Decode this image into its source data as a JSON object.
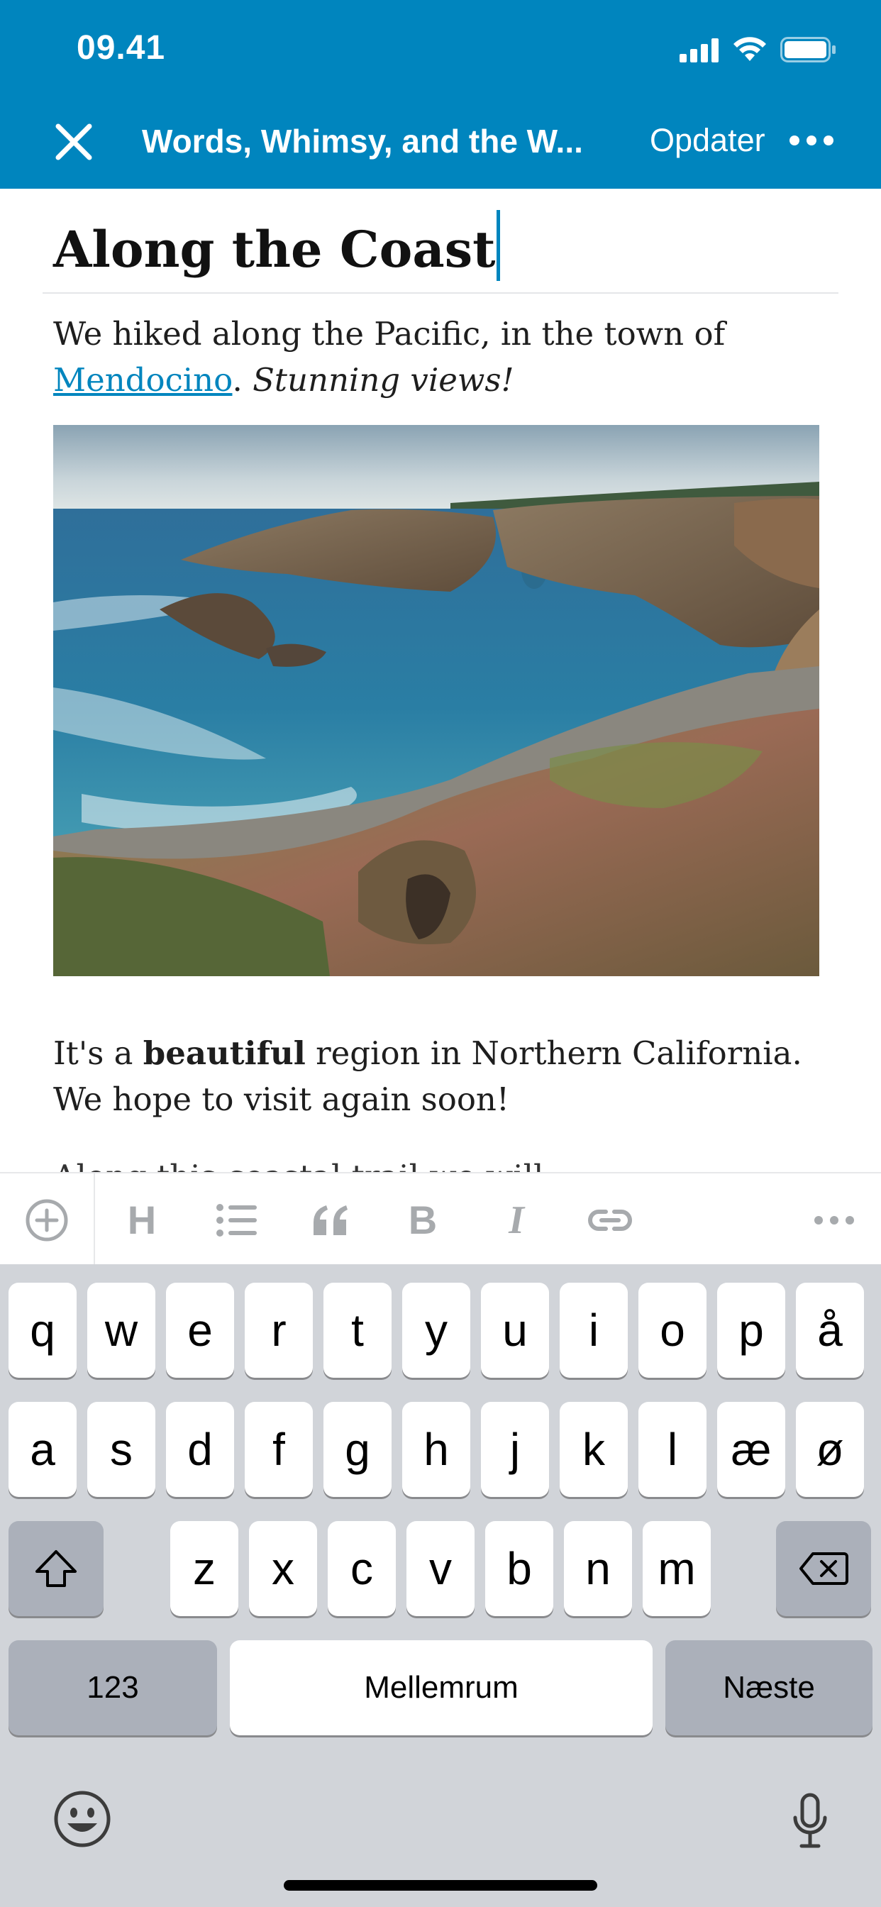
{
  "status": {
    "time": "09.41"
  },
  "header": {
    "doc_title": "Words, Whimsy, and the W...",
    "update_label": "Opdater"
  },
  "post": {
    "title": "Along the Coast",
    "p1_text_a": "We hiked along the Pacific, in the town of ",
    "p1_link": "Mendocino",
    "p1_text_b": ". ",
    "p1_italic": "Stunning views!",
    "p2_text_a": "It's a ",
    "p2_bold": "beautiful",
    "p2_text_b": " region in Northern California. We hope to visit again soon!",
    "p3_partial": "Along this coastal trail we will..."
  },
  "toolbar": {
    "heading_label": "H",
    "bold_label": "B",
    "italic_label": "I",
    "icons": [
      "add-block-icon",
      "heading-icon",
      "list-icon",
      "quote-icon",
      "bold-icon",
      "italic-icon",
      "link-icon",
      "more-icon"
    ]
  },
  "keyboard": {
    "row1": [
      "q",
      "w",
      "e",
      "r",
      "t",
      "y",
      "u",
      "i",
      "o",
      "p",
      "å"
    ],
    "row2": [
      "a",
      "s",
      "d",
      "f",
      "g",
      "h",
      "j",
      "k",
      "l",
      "æ",
      "ø"
    ],
    "row3": [
      "z",
      "x",
      "c",
      "v",
      "b",
      "n",
      "m"
    ],
    "numbers_label": "123",
    "space_label": "Mellemrum",
    "return_label": "Næste"
  },
  "colors": {
    "accent": "#0085be",
    "keyboard_bg": "#d1d4d9",
    "toolbar_icon": "#a7aaad"
  }
}
